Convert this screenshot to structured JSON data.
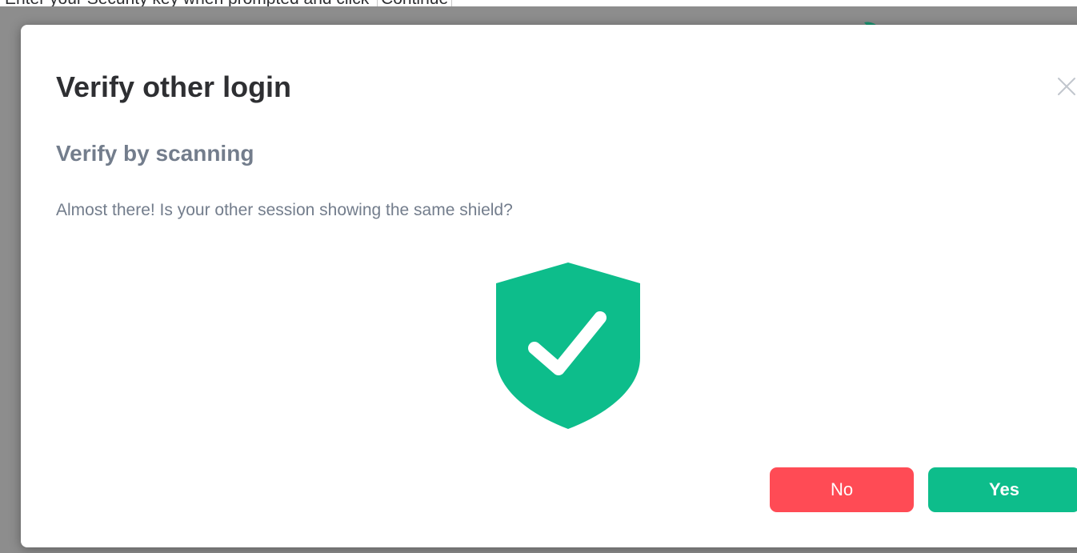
{
  "top_instruction": {
    "text": "Enter your Security key when prompted and click",
    "key_label": "Continue"
  },
  "dialog": {
    "title": "Verify other login",
    "section_heading": "Verify by scanning",
    "description": "Almost there! Is your other session showing the same shield?",
    "shield_icon": "shield-check-icon",
    "close_icon": "close-icon"
  },
  "buttons": {
    "no_label": "No",
    "yes_label": "Yes"
  },
  "colors": {
    "accent_green": "#0dbd8b",
    "danger_red": "#ff4b55",
    "title_text": "#2e2f32",
    "secondary_text": "#737d8c",
    "backdrop": "#8d8d8d"
  }
}
